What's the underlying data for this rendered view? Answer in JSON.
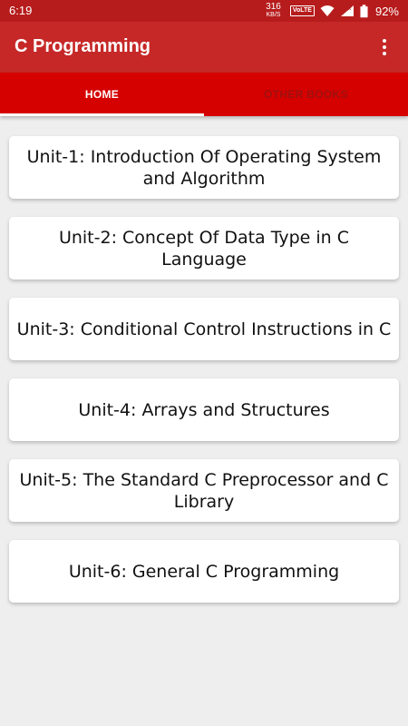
{
  "status_bar": {
    "time": "6:19",
    "net_speed_value": "316",
    "net_speed_unit": "KB/S",
    "volte": "VoLTE",
    "battery": "92%"
  },
  "app_bar": {
    "title": "C Programming",
    "menu_icon": "more-vert-icon"
  },
  "tabs": [
    {
      "label": "HOME",
      "selected": true
    },
    {
      "label": "OTHER BOOKS",
      "selected": false
    }
  ],
  "units": [
    {
      "label": "Unit-1: Introduction Of Operating System and Algorithm"
    },
    {
      "label": "Unit-2: Concept Of Data Type in C Language"
    },
    {
      "label": "Unit-3: Conditional Control Instructions in C"
    },
    {
      "label": "Unit-4: Arrays and Structures"
    },
    {
      "label": "Unit-5: The Standard C Preprocessor and C Library"
    },
    {
      "label": "Unit-6: General C Programming"
    }
  ],
  "colors": {
    "status_bar": "#b71c1c",
    "app_bar": "#c62828",
    "tab_bar": "#d50000",
    "background": "#eeeeee"
  }
}
